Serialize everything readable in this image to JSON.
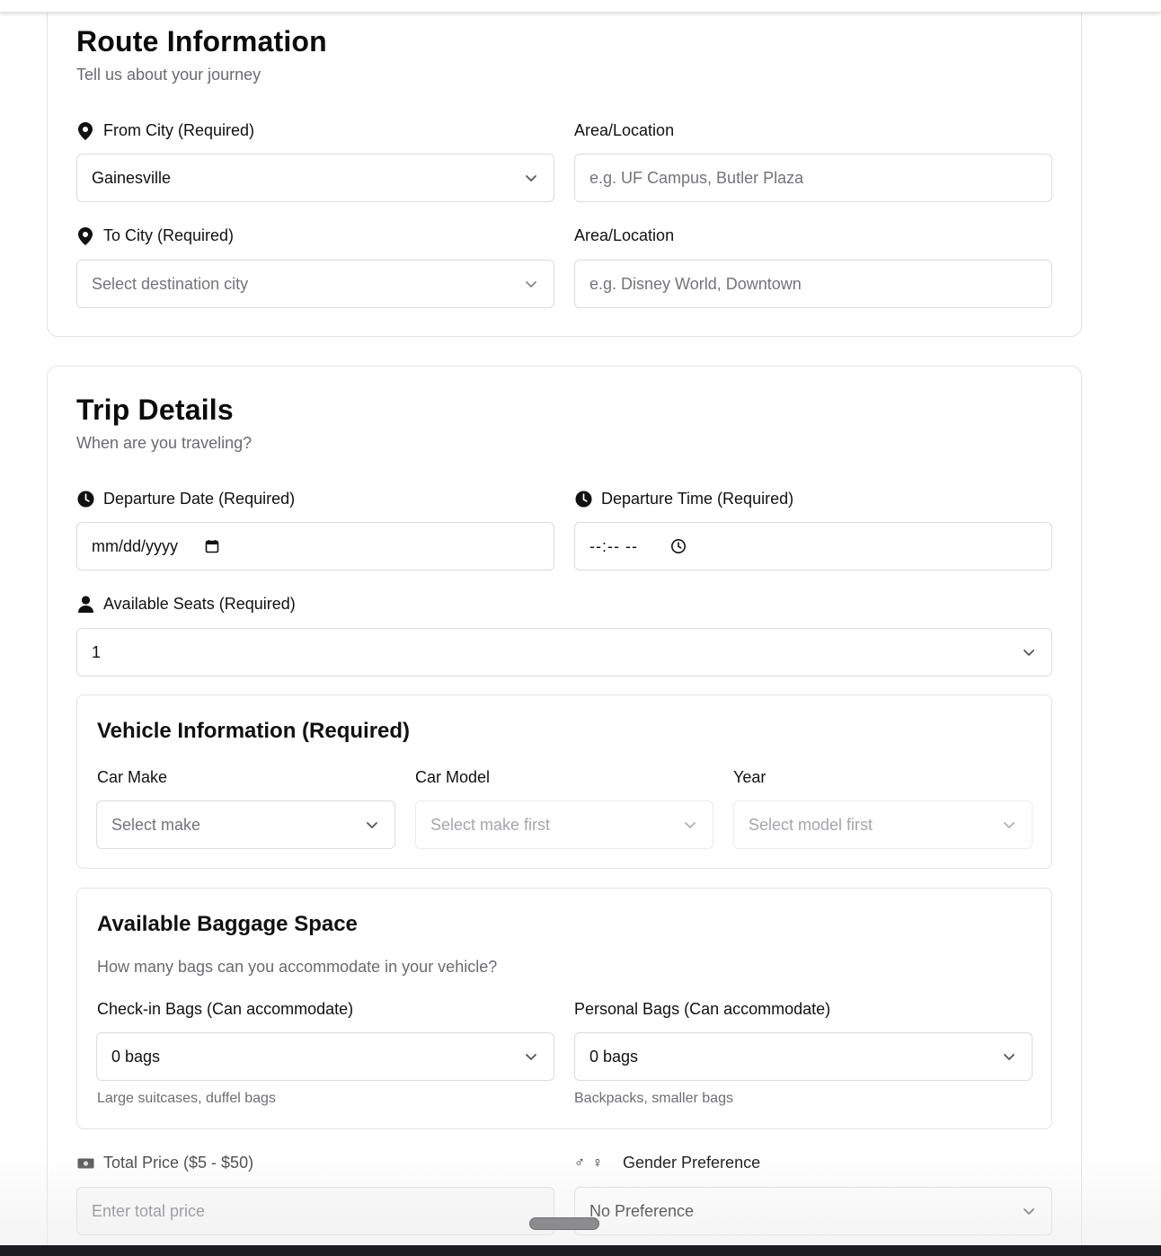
{
  "route": {
    "title": "Route Information",
    "subtitle": "Tell us about your journey",
    "from_label": "From City (Required)",
    "from_value": "Gainesville",
    "from_area_label": "Area/Location",
    "from_area_placeholder": "e.g. UF Campus, Butler Plaza",
    "to_label": "To City (Required)",
    "to_placeholder": "Select destination city",
    "to_area_label": "Area/Location",
    "to_area_placeholder": "e.g. Disney World, Downtown"
  },
  "trip": {
    "title": "Trip Details",
    "subtitle": "When are you traveling?",
    "date_label": "Departure Date (Required)",
    "date_placeholder": "mm/dd/yyyy",
    "time_label": "Departure Time (Required)",
    "time_placeholder": "--:-- --",
    "seats_label": "Available Seats (Required)",
    "seats_value": "1"
  },
  "vehicle": {
    "title": "Vehicle Information (Required)",
    "make_label": "Car Make",
    "make_placeholder": "Select make",
    "model_label": "Car Model",
    "model_placeholder": "Select make first",
    "year_label": "Year",
    "year_placeholder": "Select model first"
  },
  "baggage": {
    "title": "Available Baggage Space",
    "subtitle": "How many bags can you accommodate in your vehicle?",
    "checkin_label": "Check-in Bags (Can accommodate)",
    "checkin_value": "0 bags",
    "checkin_hint": "Large suitcases, duffel bags",
    "personal_label": "Personal Bags (Can accommodate)",
    "personal_value": "0 bags",
    "personal_hint": "Backpacks, smaller bags"
  },
  "price": {
    "label": "Total Price ($5 - $50)",
    "placeholder": "Enter total price"
  },
  "gender": {
    "label": "Gender Preference",
    "value": "No Preference"
  },
  "icons": {
    "location": "map-pin-icon",
    "clock": "clock-icon",
    "person": "person-icon",
    "money": "money-icon",
    "gender": "gender-icon",
    "chevron": "chevron-down-icon",
    "calendar": "calendar-icon"
  }
}
